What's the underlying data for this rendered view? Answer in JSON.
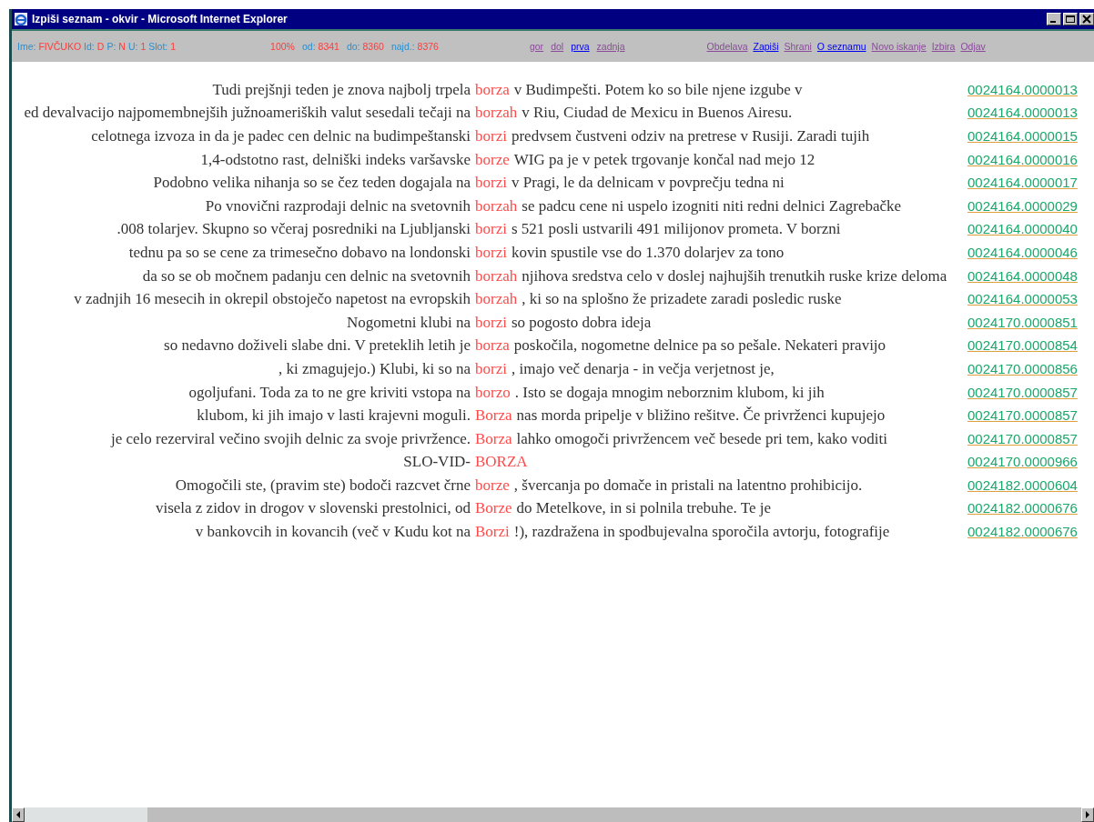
{
  "window": {
    "title": "Izpiši seznam - okvir - Microsoft Internet Explorer"
  },
  "status": {
    "fields": [
      {
        "label": "Ime:",
        "value": "FIVČUKO"
      },
      {
        "label": "Id:",
        "value": "D"
      },
      {
        "label": "P:",
        "value": "N"
      },
      {
        "label": "U:",
        "value": "1"
      },
      {
        "label": "Slot:",
        "value": "1"
      }
    ],
    "percent": "100%",
    "range": [
      {
        "label": "od:",
        "value": "8341"
      },
      {
        "label": "do:",
        "value": "8360"
      },
      {
        "label": "najd.:",
        "value": "8376"
      }
    ]
  },
  "nav_links": [
    {
      "label": "gor",
      "visited": true
    },
    {
      "label": "dol",
      "visited": true
    },
    {
      "label": "prva",
      "visited": false
    },
    {
      "label": "zadnja",
      "visited": true
    }
  ],
  "menu_links": [
    {
      "label": "Obdelava",
      "visited": true
    },
    {
      "label": "Zapiši",
      "visited": false
    },
    {
      "label": "Shrani",
      "visited": true
    },
    {
      "label": "O seznamu",
      "visited": false
    },
    {
      "label": "Novo iskanje",
      "visited": true
    },
    {
      "label": "Izbira",
      "visited": true
    },
    {
      "label": "Odjav",
      "visited": true
    }
  ],
  "rows": [
    {
      "left": "Tudi prejšnji teden je znova najbolj trpela",
      "keyword": "borza",
      "right": "v Budimpešti. Potem ko so bile njene izgube v",
      "ref": "0024164.0000013"
    },
    {
      "left": "ed devalvacijo najpomembnejših južnoameriških valut sesedali tečaji na",
      "keyword": "borzah",
      "right": "v Riu, Ciudad de Mexicu in Buenos Airesu.",
      "ref": "0024164.0000013"
    },
    {
      "left": "celotnega izvoza in da je padec cen delnic na budimpeštanski",
      "keyword": "borzi",
      "right": "predvsem čustveni odziv na pretrese v Rusiji. Zaradi tujih",
      "ref": "0024164.0000015"
    },
    {
      "left": "1,4-odstotno rast, delniški indeks varšavske",
      "keyword": "borze",
      "right": "WIG pa je v petek trgovanje končal nad mejo 12",
      "ref": "0024164.0000016"
    },
    {
      "left": "Podobno velika nihanja so se čez teden dogajala na",
      "keyword": "borzi",
      "right": "v Pragi, le da delnicam v povprečju tedna ni",
      "ref": "0024164.0000017"
    },
    {
      "left": "Po vnovični razprodaji delnic na svetovnih",
      "keyword": "borzah",
      "right": "se padcu cene ni uspelo izogniti niti redni delnici Zagrebačke",
      "ref": "0024164.0000029"
    },
    {
      "left": ".008 tolarjev. Skupno so včeraj posredniki na Ljubljanski",
      "keyword": "borzi",
      "right": "s 521 posli ustvarili 491 milijonov prometa. V borzni",
      "ref": "0024164.0000040"
    },
    {
      "left": "tednu pa so se cene za trimesečno dobavo na londonski",
      "keyword": "borzi",
      "right": "kovin spustile vse do 1.370 dolarjev za tono",
      "ref": "0024164.0000046"
    },
    {
      "left": "da so se ob močnem padanju cen delnic na svetovnih",
      "keyword": "borzah",
      "right": "njihova sredstva celo v doslej najhujših trenutkih ruske krize deloma",
      "ref": "0024164.0000048"
    },
    {
      "left": "v zadnjih 16 mesecih in okrepil obstoječo napetost na evropskih",
      "keyword": "borzah",
      "right": ", ki so na splošno že prizadete zaradi posledic ruske",
      "ref": "0024164.0000053"
    },
    {
      "left": "Nogometni klubi na",
      "keyword": "borzi",
      "right": "so pogosto dobra ideja",
      "ref": "0024170.0000851"
    },
    {
      "left": "so nedavno doživeli slabe dni. V preteklih letih je",
      "keyword": "borza",
      "right": "poskočila, nogometne delnice pa so pešale. Nekateri pravijo",
      "ref": "0024170.0000854"
    },
    {
      "left": ", ki zmagujejo.) Klubi, ki so na",
      "keyword": "borzi",
      "right": ", imajo več denarja - in večja verjetnost je,",
      "ref": "0024170.0000856"
    },
    {
      "left": "ogoljufani. Toda za to ne gre kriviti vstopa na",
      "keyword": "borzo",
      "right": ". Isto se dogaja mnogim neborznim klubom, ki jih",
      "ref": "0024170.0000857"
    },
    {
      "left": "klubom, ki jih imajo v lasti krajevni moguli.",
      "keyword": "Borza",
      "right": "nas morda pripelje v bližino rešitve. Če privrženci kupujejo",
      "ref": "0024170.0000857"
    },
    {
      "left": "je celo rezerviral večino svojih delnic za svoje privržence.",
      "keyword": "Borza",
      "right": "lahko omogoči privržencem več besede pri tem, kako voditi",
      "ref": "0024170.0000857"
    },
    {
      "left": "SLO-VID-",
      "keyword": "BORZA",
      "ref": "0024170.0000966"
    },
    {
      "left": "Omogočili ste, (pravim ste) bodoči razcvet črne",
      "keyword": "borze",
      "right": ", švercanja po domače in pristali na latentno prohibicijo.",
      "ref": "0024182.0000604"
    },
    {
      "left": "visela z zidov in drogov v slovenski prestolnici, od",
      "keyword": "Borze",
      "right": "do Metelkove, in si polnila trebuhe. Te je",
      "ref": "0024182.0000676"
    },
    {
      "left": "v bankovcih in kovancih (več v Kudu kot na",
      "keyword": "Borzi",
      "right": "!), razdražena in spodbujevalna sporočila avtorju, fotografije",
      "ref": "0024182.0000676"
    }
  ]
}
